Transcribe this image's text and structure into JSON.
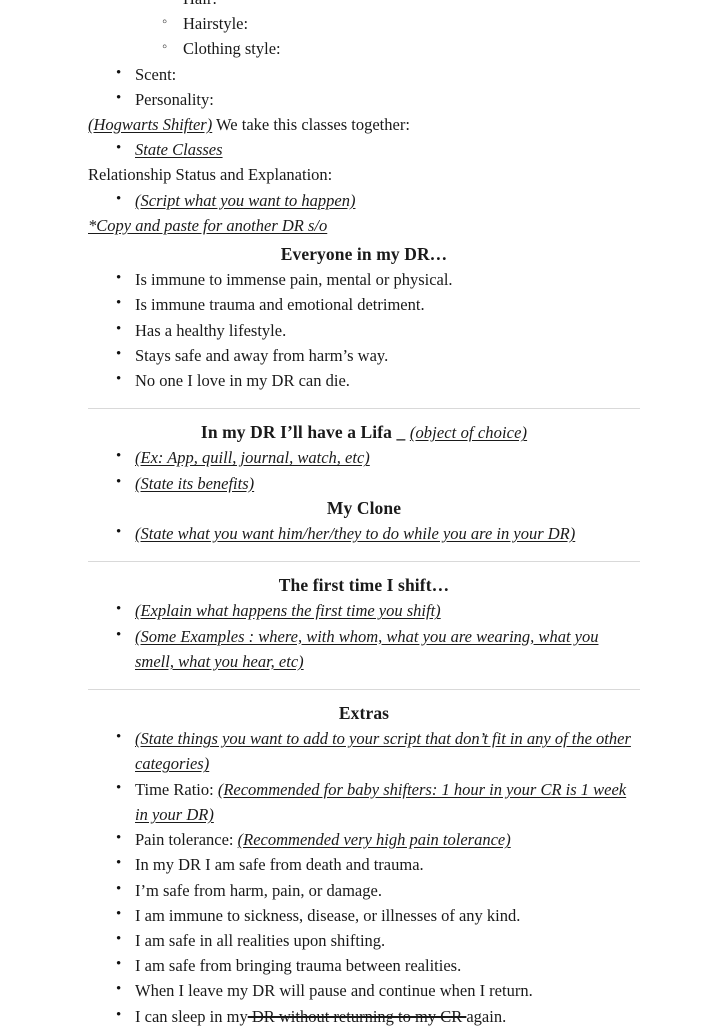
{
  "document": {
    "top_partial_items": [
      {
        "text": "Hair:",
        "level": 2,
        "style": "plain"
      },
      {
        "text": "Hairstyle:",
        "level": 2,
        "style": "plain"
      },
      {
        "text": "Clothing style:",
        "level": 2,
        "style": "plain"
      }
    ],
    "appearance_items": [
      {
        "text": "Scent:",
        "level": 1,
        "style": "plain"
      },
      {
        "text": "Personality:",
        "level": 1,
        "style": "plain"
      }
    ],
    "hogwarts_line": {
      "emphasis": "(Hogwarts Shifter)",
      "rest": " We take this classes together:"
    },
    "classes_items": [
      {
        "text": "State Classes",
        "style": "underline-italic"
      }
    ],
    "relationship_label": "Relationship Status and Explanation:",
    "relationship_items": [
      {
        "text": "(Script what you want to happen)",
        "style": "underline-italic"
      }
    ],
    "copy_paste_note": "*Copy and paste for another DR s/o",
    "sections": [
      {
        "id": "everyone-in-my-dr",
        "heading": "Everyone in my DR…",
        "heading_suffix": "",
        "heading_suffix_emphasis": "",
        "rule_before": false,
        "items": [
          {
            "text": "Is immune to immense pain, mental or physical.",
            "style": "plain"
          },
          {
            "text": "Is immune trauma and emotional detriment.",
            "style": "plain"
          },
          {
            "text": "Has a healthy lifestyle.",
            "style": "plain"
          },
          {
            "text": "Stays safe and away from harm’s way.",
            "style": "plain"
          },
          {
            "text": "No one I love in my DR can die.",
            "style": "plain"
          }
        ]
      },
      {
        "id": "lifa-device",
        "heading": "In my DR I’ll have a Lifa",
        "heading_suffix": " _ ",
        "heading_suffix_emphasis": "(object of choice)",
        "rule_before": true,
        "items": [
          {
            "text": "(Ex: App, quill, journal, watch, etc)",
            "style": "underline-italic"
          },
          {
            "text": "(State its benefits)",
            "style": "underline-italic"
          }
        ]
      },
      {
        "id": "my-clone",
        "heading": "My Clone",
        "heading_suffix": "",
        "heading_suffix_emphasis": "",
        "rule_before": false,
        "items": [
          {
            "text": "(State what you want him/her/they to do while you are in your DR)",
            "style": "underline-italic"
          }
        ]
      },
      {
        "id": "first-time-i-shift",
        "heading": "The first time I shift…",
        "heading_suffix": "",
        "heading_suffix_emphasis": "",
        "rule_before": true,
        "items": [
          {
            "text": "(Explain what happens the first time you shift)",
            "style": "underline-italic"
          },
          {
            "text": "(Some Examples : where, with whom, what you are wearing, what you smell, what you hear, etc)",
            "style": "underline-italic"
          }
        ]
      },
      {
        "id": "extras",
        "heading": "Extras",
        "heading_suffix": "",
        "heading_suffix_emphasis": "",
        "rule_before": true,
        "items": [
          {
            "text": "(State things you want to add to your script that don’t fit in any of the other categories)",
            "style": "underline-italic"
          },
          {
            "prefix": "Time Ratio: ",
            "text": "(Recommended for baby shifters: 1 hour in your CR is 1 week in your DR)",
            "style": "prefix-underline-italic"
          },
          {
            "prefix": "Pain tolerance: ",
            "text": "(Recommended very high pain tolerance)",
            "style": "prefix-underline-italic"
          },
          {
            "text": "In my DR I am safe from death and trauma.",
            "style": "plain"
          },
          {
            "text": "I’m safe from harm, pain, or damage.",
            "style": "plain"
          },
          {
            "text": "I am immune to sickness, disease, or illnesses of any kind.",
            "style": "plain"
          },
          {
            "text": "I am safe in all realities upon shifting.",
            "style": "plain"
          },
          {
            "text": "I am safe from bringing trauma between realities.",
            "style": "plain"
          },
          {
            "text": "When I leave my DR will pause and continue when I return.",
            "style": "plain"
          },
          {
            "prefix": "I can sleep in my",
            "struck": " DR without returning to my CR ",
            "suffix": "again.",
            "style": "struck-middle"
          }
        ]
      }
    ]
  }
}
